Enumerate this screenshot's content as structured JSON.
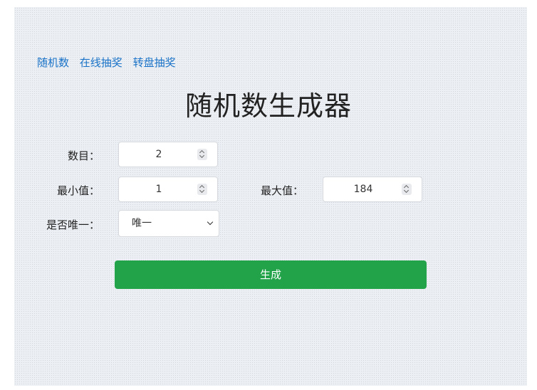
{
  "nav": {
    "items": [
      "随机数",
      "在线抽奖",
      "转盘抽奖"
    ]
  },
  "title": "随机数生成器",
  "form": {
    "count": {
      "label": "数目：",
      "value": "2"
    },
    "min": {
      "label": "最小值：",
      "value": "1"
    },
    "max": {
      "label": "最大值：",
      "value": "184"
    },
    "unique": {
      "label": "是否唯一：",
      "selected": "唯一"
    }
  },
  "generate_label": "生成",
  "colors": {
    "link": "#1a73c8",
    "button": "#22a34a",
    "panel": "#eceff3"
  }
}
